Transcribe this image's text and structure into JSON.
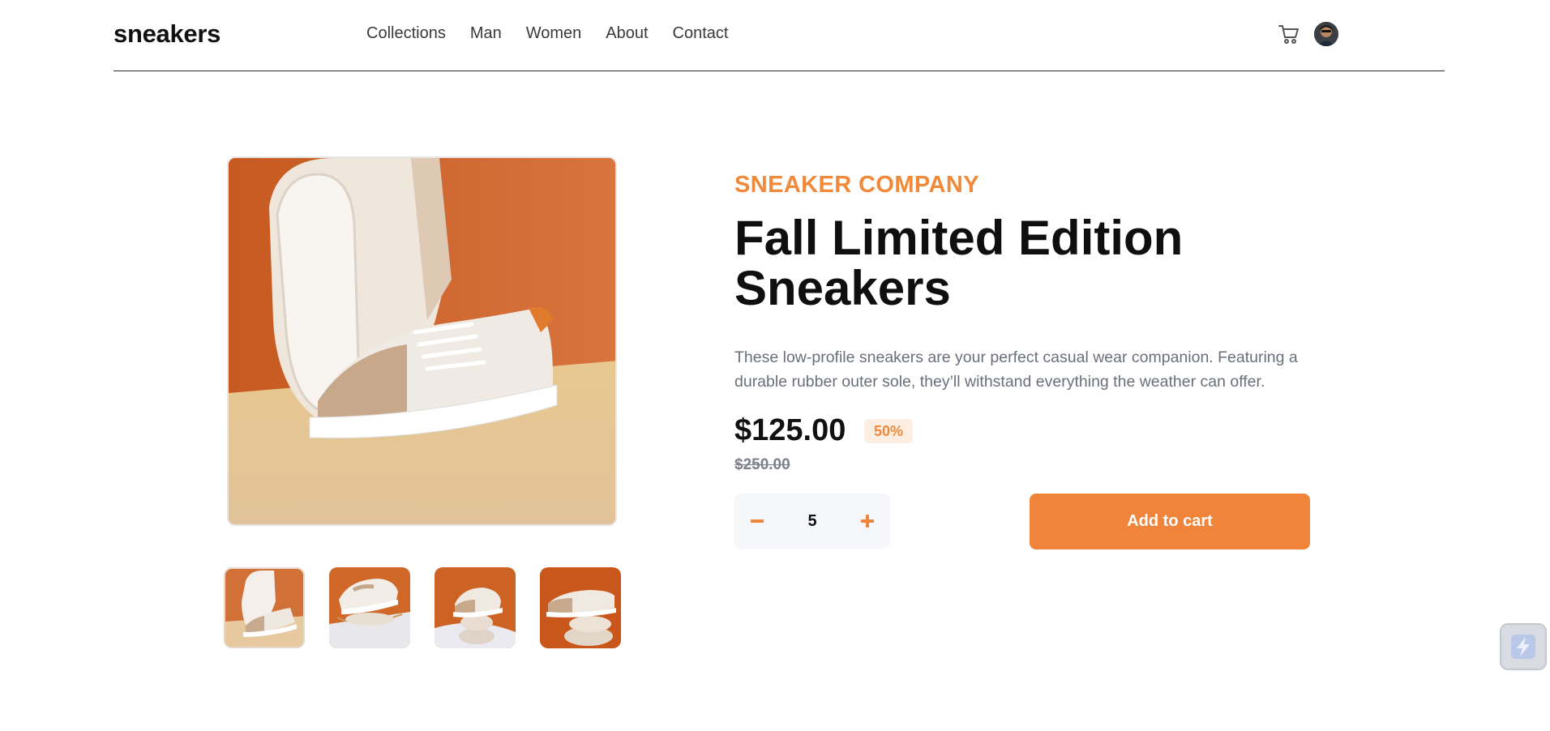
{
  "header": {
    "logo": "sneakers",
    "nav": [
      "Collections",
      "Man",
      "Women",
      "About",
      "Contact"
    ]
  },
  "product": {
    "company": "SNEAKER COMPANY",
    "title": "Fall Limited Edition Sneakers",
    "description": "These low-profile sneakers are your perfect casual wear companion. Featuring a durable rubber outer sole, they’ll withstand everything the weather can offer.",
    "price": "$125.00",
    "discount": "50%",
    "old_price": "$250.00",
    "quantity": "5",
    "add_to_cart_label": "Add to cart"
  },
  "icons": {
    "cart": "cart-icon",
    "avatar": "avatar",
    "minus": "minus-icon",
    "plus": "plus-icon",
    "widget": "lightning-icon"
  },
  "colors": {
    "accent": "#f0843b",
    "accent_light": "#fdeee4",
    "text_dark": "#1d2026",
    "text_muted": "#6a6f7a",
    "qty_bg": "#f5f7fb"
  }
}
